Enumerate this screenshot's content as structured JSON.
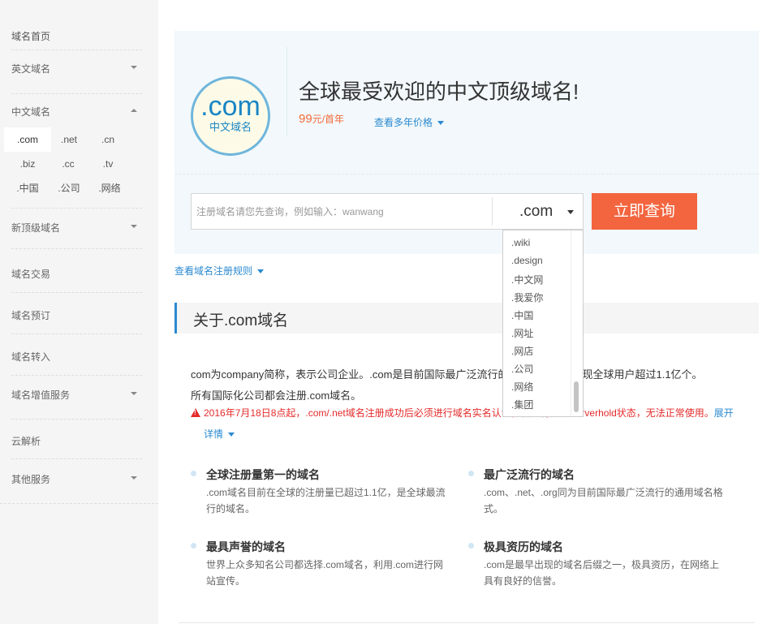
{
  "sidebar": {
    "home": "域名首页",
    "items": [
      {
        "label": "英文域名"
      },
      {
        "label": "中文域名"
      },
      {
        "label": "新顶级域名"
      },
      {
        "label": "域名交易"
      },
      {
        "label": "域名预订"
      },
      {
        "label": "域名转入"
      },
      {
        "label": "域名增值服务"
      },
      {
        "label": "云解析"
      },
      {
        "label": "其他服务"
      }
    ],
    "sub_items": [
      ".com",
      ".net",
      ".cn",
      ".biz",
      ".cc",
      ".tv",
      ".中国",
      ".公司",
      ".网络"
    ]
  },
  "hero": {
    "logo_main": ".com",
    "logo_sub": "中文域名",
    "title": "全球最受欢迎的中文顶级域名!",
    "price_value": "99",
    "price_unit": "元/首年",
    "multi_year": "查看多年价格"
  },
  "search": {
    "placeholder": "注册域名请您先查询，例如输入：wanwang",
    "suffix": ".com",
    "button": "立即查询"
  },
  "dropdown": {
    "options": [
      ".wiki",
      ".design",
      ".中文网",
      ".我爱你",
      ".中国",
      ".网址",
      ".网店",
      ".公司",
      ".网络",
      ".集团"
    ]
  },
  "rule_link": "查看域名注册规则",
  "about": {
    "title": "关于.com域名",
    "desc_line1": "com为company简称，表示公司企业。.com是目前国际最广泛流行的通用域名格式，现全球用户超过1.1亿个。",
    "desc_line2": "所有国际化公司都会注册.com域名。",
    "warning": "2016年7月18日8点起，.com/.net域名注册成功后必须进行域名实名认证，否则将处于Serverhold状态，无法正常使用。",
    "expand": "展开",
    "detail": "详情"
  },
  "features": [
    {
      "title": "全球注册量第一的域名",
      "desc": ".com域名目前在全球的注册量已超过1.1亿，是全球最流行的域名。"
    },
    {
      "title": "最广泛流行的域名",
      "desc": ".com、.net、.org同为目前国际最广泛流行的通用域名格式。"
    },
    {
      "title": "最具声誉的域名",
      "desc": "世界上众多知名公司都选择.com域名，利用.com进行网站宣传。"
    },
    {
      "title": "极具资历的域名",
      "desc": ".com是最早出现的域名后缀之一，极具资历，在网络上具有良好的信誉。"
    }
  ],
  "colors": {
    "accent": "#2b8ad0",
    "button": "#f3653f",
    "price": "#f36a3b",
    "warning": "#e52b2b"
  }
}
